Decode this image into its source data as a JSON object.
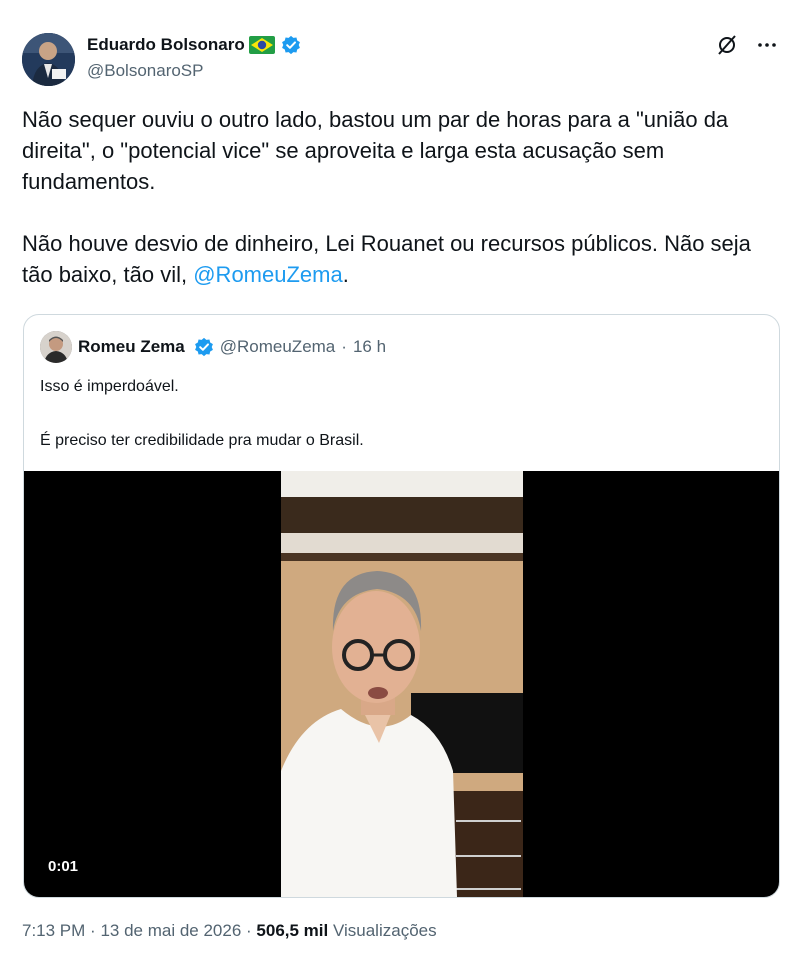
{
  "author": {
    "name": "Eduardo Bolsonaro",
    "handle": "@BolsonaroSP",
    "flag_icon": "brazil-flag-icon",
    "verified_icon": "verified-badge-icon"
  },
  "tweet": {
    "text_part1": "Não sequer ouviu o outro lado, bastou um par de horas para a \"união da direita\", o \"potencial vice\" se aproveita e larga esta acusação sem fundamentos.\n\nNão houve desvio de dinheiro, Lei Rouanet ou recursos públicos. Não seja tão baixo, tão vil, ",
    "mention": "@RomeuZema",
    "text_part2": "."
  },
  "quote": {
    "name": "Romeu Zema",
    "handle": "@RomeuZema",
    "separator": "·",
    "time": "16 h",
    "text": "Isso é imperdoável.\n\nÉ preciso ter credibilidade pra mudar o Brasil.",
    "video_time": "0:01"
  },
  "footer": {
    "time": "7:13 PM",
    "date": "13 de mai de 2026",
    "views_count": "506,5 mil",
    "views_label": "Visualizações"
  },
  "colors": {
    "accent": "#1d9bf0",
    "text": "#0f1419",
    "secondary": "#536471",
    "border": "#cfd9de"
  }
}
